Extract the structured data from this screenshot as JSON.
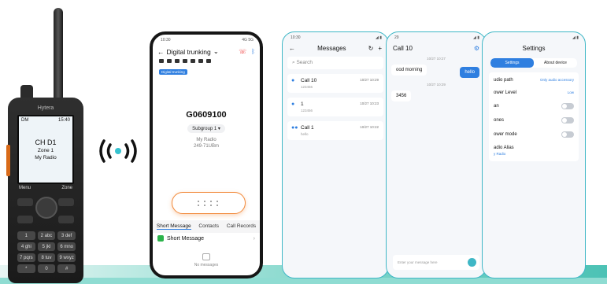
{
  "radio": {
    "brand": "Hytera",
    "status_left": "DM",
    "time": "15:40",
    "channel": "CH D1",
    "zone": "Zone 1",
    "name": "My Radio",
    "softkey_left": "Menu",
    "softkey_right": "Zone",
    "keys": [
      "1",
      "2 abc",
      "3 def",
      "4 ghi",
      "5 jkl",
      "6 mno",
      "7 pqrs",
      "8 tuv",
      "9 wxyz",
      "*",
      "0",
      "#"
    ]
  },
  "phone1": {
    "time": "10:30",
    "signal": "4G 5G",
    "title": "Digital trunking",
    "tag": "Digital trunking",
    "group_id": "G0609100",
    "subgroup": "Subgroup 1",
    "my_radio": "My Radio",
    "number": "249-71UBm",
    "tabs": [
      "Short Message",
      "Contacts",
      "Call Records"
    ],
    "sms_item": "Short Message",
    "empty": "No messages"
  },
  "phone2": {
    "time": "10:30",
    "title": "Messages",
    "search_placeholder": "Search",
    "messages": [
      {
        "title": "Call 10",
        "preview": "123456",
        "time": "10/27 10:29"
      },
      {
        "title": "1",
        "preview": "123456",
        "time": "10/27 10:23"
      },
      {
        "title": "Call 1",
        "preview": "hello",
        "time": "10/27 10:22"
      }
    ]
  },
  "phone3": {
    "time": "29",
    "title": "Call 10",
    "ts1": "10/27 10:27",
    "msg_in": "ood morning",
    "msg_out": "hello",
    "ts2": "10/27 10:29",
    "msg_in2": "3456",
    "composer": "Enter your message here"
  },
  "phone4": {
    "title": "Settings",
    "tabs": [
      "Settings",
      "About device"
    ],
    "rows": [
      {
        "label": "udio path",
        "value": "Only audio accessory"
      },
      {
        "label": "ower Level",
        "value": "Low"
      },
      {
        "label": "an",
        "value": ""
      },
      {
        "label": "ones",
        "value": ""
      },
      {
        "label": "ower mode",
        "value": ""
      },
      {
        "label": "adio Alias",
        "value": "y Radio"
      }
    ]
  }
}
